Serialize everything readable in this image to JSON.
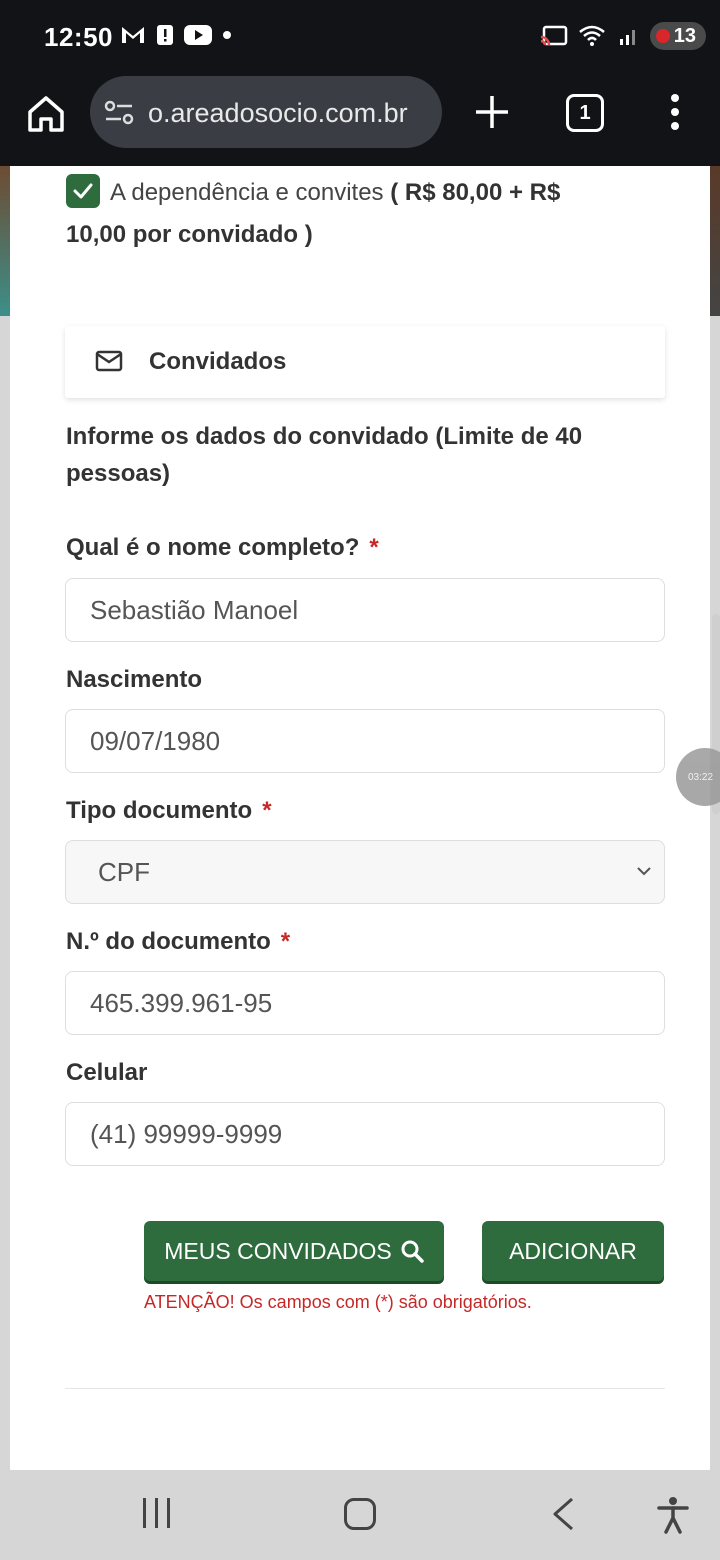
{
  "status_bar": {
    "time": "12:50",
    "battery": "13",
    "icons_left": [
      "gmail-icon",
      "alert-icon",
      "youtube-icon",
      "dot-icon"
    ],
    "icons_right": [
      "cast-icon",
      "wifi-icon",
      "signal-icon"
    ]
  },
  "browser": {
    "url": "o.areadosocio.com.br",
    "tab_count": "1"
  },
  "form": {
    "checkbox": {
      "label": "A dependência e convites",
      "price": "( R$ 80,00 + R$ 10,00 por convidado )",
      "checked": true
    },
    "section_title": "Convidados",
    "instructions": "Informe os dados do convidado (Limite de 40 pessoas)",
    "fields": {
      "name": {
        "label": "Qual é o nome completo?",
        "value": "Sebastião Manoel",
        "required_mark": "*"
      },
      "birth": {
        "label": "Nascimento",
        "value": "09/07/1980"
      },
      "doc_type": {
        "label": "Tipo documento",
        "value": "CPF",
        "required_mark": "*"
      },
      "doc_number": {
        "label": "N.º do documento",
        "value": "465.399.961-95",
        "required_mark": "*"
      },
      "phone": {
        "label": "Celular",
        "placeholder": "(41) 99999-9999"
      }
    },
    "buttons": {
      "my_guests": "MEUS CONVIDADOS",
      "add": "ADICIONAR"
    },
    "warning": "ATENÇÃO! Os campos com (*) são obrigatórios."
  },
  "overlay": {
    "timer": "03:22"
  },
  "colors": {
    "accent": "#2e6b3d",
    "required": "#c62828",
    "status_bar_bg": "#111316"
  }
}
